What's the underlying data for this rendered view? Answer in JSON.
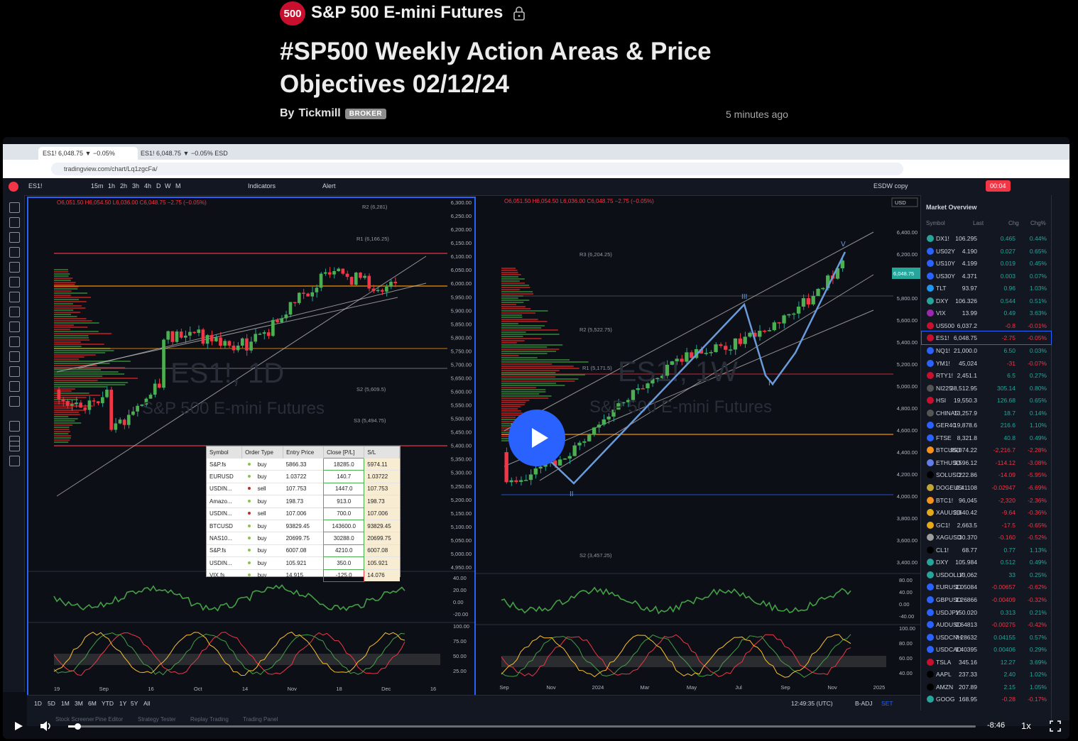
{
  "header": {
    "badge": "500",
    "symbol_title": "S&P 500 E-mini Futures",
    "idea_title": "#SP500 Weekly Action Areas & Price Objectives 02/12/24",
    "byline_prefix": "By",
    "author": "Tickmill",
    "author_badge": "BROKER",
    "time_ago": "5 minutes ago"
  },
  "browser": {
    "tabs": [
      "ES1! 6,048.75 ▼ −0.05%",
      "ES1! 6,048.75 ▼ −0.05% ESD"
    ],
    "url": "tradingview.com/chart/Lq1zgcFa/"
  },
  "tv_toolbar": {
    "symbol": "ES1!",
    "intervals": [
      "15m",
      "1h",
      "2h",
      "3h",
      "4h",
      "D",
      "W",
      "M"
    ],
    "indicators": "Indicators",
    "alert": "Alert",
    "layout_name": "ESDW copy",
    "timer": "00:04"
  },
  "left_chart": {
    "ohlc": "O6,051.50 H6,054.50 L6,036.00 C6,048.75 −2.75 (−0.05%)",
    "watermark_symbol": "ES1!, 1D",
    "watermark_name": "S&P 500 E-mini Futures",
    "price_ticks": [
      "6,300.00",
      "6,250.00",
      "6,200.00",
      "6,150.00",
      "6,100.00",
      "6,050.00",
      "6,000.00",
      "5,950.00",
      "5,900.00",
      "5,850.00",
      "5,800.00",
      "5,750.00",
      "5,700.00",
      "5,650.00",
      "5,600.00",
      "5,550.00",
      "5,500.00",
      "5,450.00",
      "5,400.00",
      "5,350.00",
      "5,300.00",
      "5,250.00",
      "5,200.00",
      "5,150.00",
      "5,100.00",
      "5,050.00",
      "5,000.00",
      "4,950.00"
    ],
    "time_ticks": [
      "19",
      "Sep",
      "16",
      "Oct",
      "14",
      "Nov",
      "18",
      "Dec",
      "16"
    ],
    "osc_ticks": [
      "40.00",
      "20.00",
      "0.00",
      "-20.00"
    ],
    "stoch_ticks": [
      "100.00",
      "75.00",
      "50.00",
      "25.00"
    ],
    "levels": [
      "R2 (6,281)",
      "R1 (6,166.25)",
      "S2 (5,609.5)",
      "S3 (5,494.75)"
    ]
  },
  "right_chart": {
    "ohlc": "O6,051.50 H6,054.50 L6,036.00 C6,048.75 −2.75 (−0.05%)",
    "watermark_symbol": "ES1!, 1W",
    "watermark_name": "S&P 500 E-mini Futures",
    "currency": "USD",
    "price_ticks": [
      "6,400.00",
      "6,200.00",
      "6,000.00",
      "5,800.00",
      "5,600.00",
      "5,400.00",
      "5,200.00",
      "5,000.00",
      "4,800.00",
      "4,600.00",
      "4,400.00",
      "4,200.00",
      "4,000.00",
      "3,800.00",
      "3,600.00",
      "3,400.00"
    ],
    "time_ticks": [
      "Sep",
      "Nov",
      "2024",
      "Mar",
      "May",
      "Jul",
      "Sep",
      "Nov",
      "2025"
    ],
    "osc_ticks": [
      "80.00",
      "40.00",
      "0.00",
      "-40.00"
    ],
    "stoch_ticks": [
      "100.00",
      "80.00",
      "60.00",
      "40.00"
    ],
    "levels": [
      "R3 (6,204.25)",
      "R2 (5,522.75)",
      "R1 (5,171.5)",
      "S2 (3,457.25)"
    ],
    "waves": [
      "V",
      "III",
      "IV",
      "II"
    ],
    "price_tag": "6,048.75"
  },
  "orders_table": {
    "headers": [
      "Symbol",
      "Order Type",
      "Entry Price",
      "Close [P/L]",
      "S/L"
    ],
    "rows": [
      {
        "symbol": "S&P.fs",
        "type": "buy",
        "entry": "5866.33",
        "pl": "18285.0",
        "sl": "5974.11"
      },
      {
        "symbol": "EURUSD",
        "type": "buy",
        "entry": "1.03722",
        "pl": "140.7",
        "sl": "1.03722"
      },
      {
        "symbol": "USDIN...",
        "type": "sell",
        "entry": "107.753",
        "pl": "1447.0",
        "sl": "107.753"
      },
      {
        "symbol": "Amazo...",
        "type": "buy",
        "entry": "198.73",
        "pl": "913.0",
        "sl": "198.73"
      },
      {
        "symbol": "USDIN...",
        "type": "sell",
        "entry": "107.006",
        "pl": "700.0",
        "sl": "107.006"
      },
      {
        "symbol": "BTCUSD",
        "type": "buy",
        "entry": "93829.45",
        "pl": "143600.0",
        "sl": "93829.45"
      },
      {
        "symbol": "NAS10...",
        "type": "buy",
        "entry": "20699.75",
        "pl": "30288.0",
        "sl": "20699.75"
      },
      {
        "symbol": "S&P.fs",
        "type": "buy",
        "entry": "6007.08",
        "pl": "4210.0",
        "sl": "6007.08"
      },
      {
        "symbol": "USDIN...",
        "type": "buy",
        "entry": "105.921",
        "pl": "350.0",
        "sl": "105.921"
      },
      {
        "symbol": "VIX.fs",
        "type": "buy",
        "entry": "14.915",
        "pl": "-125.0",
        "sl": "14.076"
      }
    ]
  },
  "market_overview": {
    "title": "Market Overview",
    "columns": [
      "Symbol",
      "Last",
      "Chg",
      "Chg%"
    ],
    "rows": [
      {
        "sym": "DX1!",
        "last": "106.295",
        "chg": "0.465",
        "pct": "0.44%",
        "dir": "up",
        "color": "#26a69a"
      },
      {
        "sym": "US02Y",
        "last": "4.190",
        "chg": "0.027",
        "pct": "0.65%",
        "dir": "up",
        "color": "#2962ff"
      },
      {
        "sym": "US10Y",
        "last": "4.199",
        "chg": "0.019",
        "pct": "0.45%",
        "dir": "up",
        "color": "#2962ff"
      },
      {
        "sym": "US30Y",
        "last": "4.371",
        "chg": "0.003",
        "pct": "0.07%",
        "dir": "up",
        "color": "#2962ff"
      },
      {
        "sym": "TLT",
        "last": "93.97",
        "chg": "0.96",
        "pct": "1.03%",
        "dir": "up",
        "color": "#2196f3"
      },
      {
        "sym": "DXY",
        "last": "106.326",
        "chg": "0.544",
        "pct": "0.51%",
        "dir": "up",
        "color": "#26a69a"
      },
      {
        "sym": "VIX",
        "last": "13.99",
        "chg": "0.49",
        "pct": "3.63%",
        "dir": "up",
        "color": "#9c27b0"
      },
      {
        "sym": "US500",
        "last": "6,037.2",
        "chg": "-0.8",
        "pct": "-0.01%",
        "dir": "down",
        "color": "#c8102e"
      },
      {
        "sym": "ES1!",
        "last": "6,048.75",
        "chg": "-2.75",
        "pct": "-0.05%",
        "dir": "down",
        "color": "#c8102e"
      },
      {
        "sym": "NQ1!",
        "last": "21,000.0",
        "chg": "6.50",
        "pct": "0.03%",
        "dir": "up",
        "color": "#2962ff"
      },
      {
        "sym": "YM1!",
        "last": "45,024",
        "chg": "-31",
        "pct": "-0.07%",
        "dir": "down",
        "color": "#2962ff"
      },
      {
        "sym": "RTY1!",
        "last": "2,451.1",
        "chg": "6.5",
        "pct": "0.27%",
        "dir": "up",
        "color": "#c8102e"
      },
      {
        "sym": "NI225",
        "last": "38,512.95",
        "chg": "305.14",
        "pct": "0.80%",
        "dir": "up",
        "color": "#555"
      },
      {
        "sym": "HSI",
        "last": "19,550.3",
        "chg": "126.68",
        "pct": "0.65%",
        "dir": "up",
        "color": "#c8102e"
      },
      {
        "sym": "CHINA5",
        "last": "13,257.9",
        "chg": "18.7",
        "pct": "0.14%",
        "dir": "up",
        "color": "#555"
      },
      {
        "sym": "GER40",
        "last": "19,878.6",
        "chg": "216.6",
        "pct": "1.10%",
        "dir": "up",
        "color": "#2962ff"
      },
      {
        "sym": "FTSE",
        "last": "8,321.8",
        "chg": "40.8",
        "pct": "0.49%",
        "dir": "up",
        "color": "#2962ff"
      },
      {
        "sym": "BTCUSD",
        "last": "95,074.22",
        "chg": "-2,216.7",
        "pct": "-2.28%",
        "dir": "down",
        "color": "#f7931a"
      },
      {
        "sym": "ETHUSD",
        "last": "3,596.12",
        "chg": "-114.12",
        "pct": "-3.08%",
        "dir": "down",
        "color": "#627eea"
      },
      {
        "sym": "SOLUSD",
        "last": "222.86",
        "chg": "-14.09",
        "pct": "-5.95%",
        "dir": "down",
        "color": "#000"
      },
      {
        "sym": "DOGEUSD",
        "last": "0.41108",
        "chg": "-0.02947",
        "pct": "-6.69%",
        "dir": "down",
        "color": "#c2a633"
      },
      {
        "sym": "BTC1!",
        "last": "96,045",
        "chg": "-2,320",
        "pct": "-2.36%",
        "dir": "down",
        "color": "#f7931a"
      },
      {
        "sym": "XAUUSD",
        "last": "2,640.42",
        "chg": "-9.64",
        "pct": "-0.36%",
        "dir": "down",
        "color": "#e6a817"
      },
      {
        "sym": "GC1!",
        "last": "2,663.5",
        "chg": "-17.5",
        "pct": "-0.65%",
        "dir": "down",
        "color": "#e6a817"
      },
      {
        "sym": "XAGUSD",
        "last": "30.370",
        "chg": "-0.160",
        "pct": "-0.52%",
        "dir": "down",
        "color": "#9e9e9e"
      },
      {
        "sym": "CL1!",
        "last": "68.77",
        "chg": "0.77",
        "pct": "1.13%",
        "dir": "up",
        "color": "#000"
      },
      {
        "sym": "DXY",
        "last": "105.984",
        "chg": "0.512",
        "pct": "0.49%",
        "dir": "up",
        "color": "#26a69a"
      },
      {
        "sym": "USDOLLAR",
        "last": "13,062",
        "chg": "33",
        "pct": "0.25%",
        "dir": "up",
        "color": "#26a69a"
      },
      {
        "sym": "EURUSD",
        "last": "1.05084",
        "chg": "-0.00657",
        "pct": "-0.62%",
        "dir": "down",
        "color": "#2962ff"
      },
      {
        "sym": "GBPUSD",
        "last": "1.26866",
        "chg": "-0.00409",
        "pct": "-0.32%",
        "dir": "down",
        "color": "#2962ff"
      },
      {
        "sym": "USDJPY",
        "last": "150.020",
        "chg": "0.313",
        "pct": "0.21%",
        "dir": "up",
        "color": "#2962ff"
      },
      {
        "sym": "AUDUSD",
        "last": "0.64813",
        "chg": "-0.00275",
        "pct": "-0.42%",
        "dir": "down",
        "color": "#2962ff"
      },
      {
        "sym": "USDCNH",
        "last": "7.28632",
        "chg": "0.04155",
        "pct": "0.57%",
        "dir": "up",
        "color": "#2962ff"
      },
      {
        "sym": "USDCAD",
        "last": "1.40395",
        "chg": "0.00406",
        "pct": "0.29%",
        "dir": "up",
        "color": "#2962ff"
      },
      {
        "sym": "TSLA",
        "last": "345.16",
        "chg": "12.27",
        "pct": "3.69%",
        "dir": "up",
        "color": "#c8102e"
      },
      {
        "sym": "AAPL",
        "last": "237.33",
        "chg": "2.40",
        "pct": "1.02%",
        "dir": "up",
        "color": "#000"
      },
      {
        "sym": "AMZN",
        "last": "207.89",
        "chg": "2.15",
        "pct": "1.05%",
        "dir": "up",
        "color": "#000"
      },
      {
        "sym": "GOOG",
        "last": "168.95",
        "chg": "-0.28",
        "pct": "-0.17%",
        "dir": "down",
        "color": "#26a69a"
      }
    ]
  },
  "bottom_bar": {
    "ranges": [
      "1D",
      "5D",
      "1M",
      "3M",
      "6M",
      "YTD",
      "1Y",
      "5Y",
      "All"
    ],
    "clock": "12:49:35 (UTC)",
    "badj": "B-ADJ",
    "set": "SET"
  },
  "panel_tabs": [
    "Stock Screener",
    "Pine Editor",
    "Strategy Tester",
    "Replay Trading",
    "Trading Panel"
  ],
  "player": {
    "time_remaining": "-8:46",
    "speed": "1x",
    "progress_fraction": 0.012
  }
}
